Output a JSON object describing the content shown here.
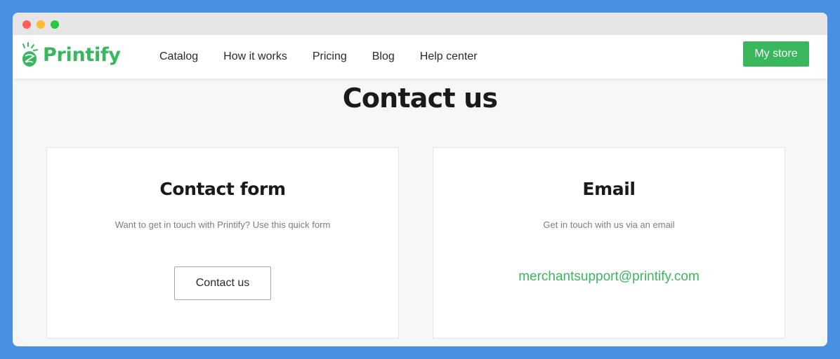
{
  "brand": {
    "name": "Printify",
    "logo_icon": "printify-logo-icon",
    "color": "#39b75d"
  },
  "nav": {
    "links": [
      {
        "label": "Catalog"
      },
      {
        "label": "How it works"
      },
      {
        "label": "Pricing"
      },
      {
        "label": "Blog"
      },
      {
        "label": "Help center"
      }
    ],
    "store_button": "My store"
  },
  "page": {
    "title": "Contact us"
  },
  "cards": {
    "form": {
      "title": "Contact form",
      "subtitle": "Want to get in touch with Printify? Use this quick form",
      "button": "Contact us"
    },
    "email": {
      "title": "Email",
      "subtitle": "Get in touch with us via an email",
      "address": "merchantsupport@printify.com"
    }
  },
  "colors": {
    "accent": "#39b75d",
    "background": "#4a90e2",
    "page": "#f6f7f7"
  }
}
